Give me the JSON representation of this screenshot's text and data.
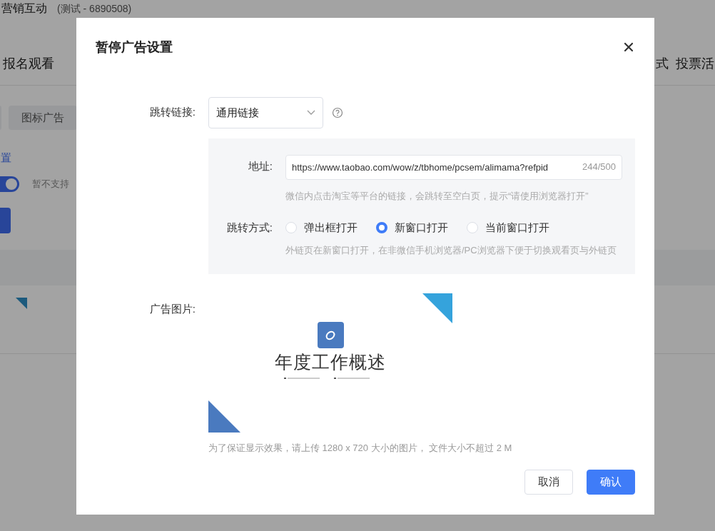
{
  "background": {
    "app_title": "营销互动",
    "app_subtitle": "(测试 - 6890508)",
    "nav_left": "报名观看",
    "nav_right": [
      "式",
      "投票活"
    ],
    "chip": "图标广告",
    "link": "置",
    "toggle": {
      "on": true
    },
    "toggle_note": "暂不支持"
  },
  "dialog": {
    "title": "暂停广告设置",
    "jump_link": {
      "label": "跳转链接:",
      "value": "通用链接"
    },
    "address": {
      "label": "地址:",
      "value": "https://www.taobao.com/wow/z/tbhome/pcsem/alimama?refpid",
      "counter": "244/500",
      "hint": "微信内点击淘宝等平台的链接，会跳转至空白页，提示“请使用浏览器打开”"
    },
    "jump_mode": {
      "label": "跳转方式:",
      "options": [
        {
          "label": "弹出框打开",
          "selected": false
        },
        {
          "label": "新窗口打开",
          "selected": true
        },
        {
          "label": "当前窗口打开",
          "selected": false
        }
      ],
      "hint": "外链页在新窗口打开，在非微信手机浏览器/PC浏览器下便于切换观看页与外链页"
    },
    "ad_image": {
      "label": "广告图片:",
      "slide_title": "年度工作概述",
      "caption": "为了保证显示效果，请上传 1280 x 720 大小的图片， 文件大小不超过 2 M"
    },
    "buttons": [
      {
        "kind": "secondary",
        "label": "取消"
      },
      {
        "kind": "primary",
        "label": "确认"
      }
    ]
  }
}
